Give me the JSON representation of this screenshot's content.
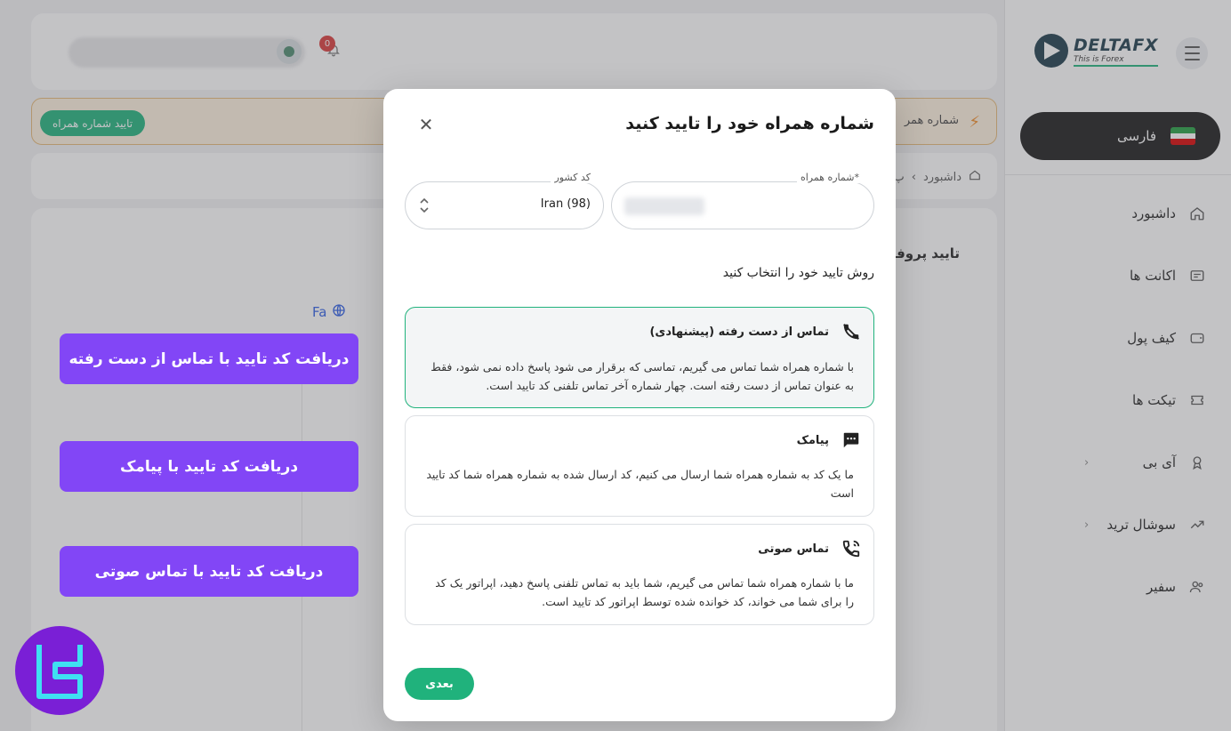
{
  "sidebar": {
    "brand": {
      "name": "DELTAFX",
      "tagline": "This is Forex"
    },
    "language": "فارسی",
    "items": [
      {
        "label": "داشبورد",
        "icon": "home-icon"
      },
      {
        "label": "اکانت ها",
        "icon": "accounts-icon"
      },
      {
        "label": "کیف پول",
        "icon": "wallet-icon"
      },
      {
        "label": "تیکت ها",
        "icon": "ticket-icon"
      },
      {
        "label": "آی بی",
        "icon": "ib-award-icon",
        "chevron": "‹"
      },
      {
        "label": "سوشال ترید",
        "icon": "trend-icon",
        "chevron": "‹"
      },
      {
        "label": "سفیر",
        "icon": "users-icon"
      }
    ]
  },
  "header": {
    "notification_count": "0"
  },
  "alert": {
    "text": "شماره همر",
    "button": "تایید شماره همراه"
  },
  "breadcrumb": {
    "home": "داشبورد",
    "sep": "›",
    "next": "پ"
  },
  "main": {
    "title": "تایید پروفا",
    "lang_switch": "Fa"
  },
  "callouts": [
    "دریافت کد تایید با تماس از دست رفته",
    "دریافت کد تایید با پیامک",
    "دریافت کد تایید با تماس صوتی"
  ],
  "modal": {
    "title": "شماره همراه خود را تایید کنید",
    "phone_label": "*شماره همراه",
    "country_label": "کد کشور",
    "country_value": "Iran (98)",
    "section_title": "روش تایید خود را انتخاب کنید",
    "options": [
      {
        "title": "تماس از دست رفته (پیشنهادی)",
        "icon": "missed-call-icon",
        "desc": "با شماره همراه شما تماس می گیریم، تماسی که برقرار می شود پاسخ داده نمی شود، فقط به عنوان تماس از دست رفته است. چهار شماره آخر تماس تلفنی کد تایید است."
      },
      {
        "title": "پیامک",
        "icon": "sms-icon",
        "desc": "ما یک کد به شماره همراه شما ارسال می کنیم، کد ارسال شده به شماره همراه شما کد تایید است"
      },
      {
        "title": "تماس صوتی",
        "icon": "voice-call-icon",
        "desc": "ما با شماره همراه شما تماس می گیریم، شما باید به تماس تلفنی پاسخ دهید، اپراتور یک کد را برای شما می خواند، کد خوانده شده توسط اپراتور کد تایید است."
      }
    ],
    "next_button": "بعدی"
  },
  "colors": {
    "accent": "#20b27c",
    "callout": "#8246f6",
    "dark": "#1a1a1a"
  }
}
